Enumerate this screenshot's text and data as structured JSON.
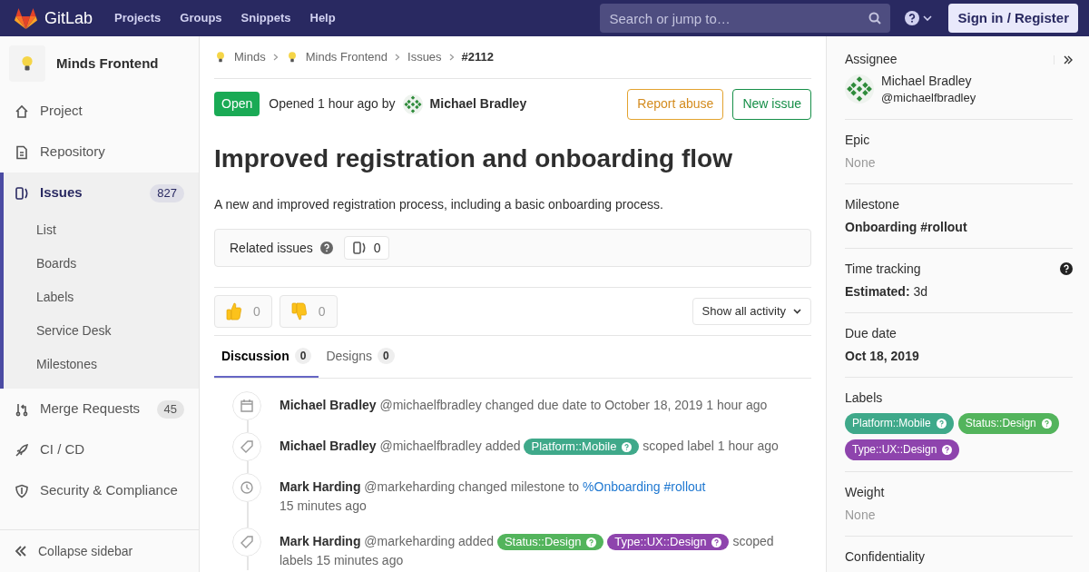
{
  "topbar": {
    "brand": "GitLab",
    "nav": [
      "Projects",
      "Groups",
      "Snippets",
      "Help"
    ],
    "search": {
      "placeholder": "Search or jump to…"
    },
    "sign_in": "Sign in / Register"
  },
  "sidebar": {
    "project": "Minds Frontend",
    "items": [
      {
        "label": "Project",
        "kind": "home",
        "selected": false
      },
      {
        "label": "Repository",
        "kind": "doc",
        "selected": false
      },
      {
        "label": "Issues",
        "kind": "issues",
        "selected": true,
        "count": "827",
        "children": [
          {
            "label": "List"
          },
          {
            "label": "Boards"
          },
          {
            "label": "Labels"
          },
          {
            "label": "Service Desk"
          },
          {
            "label": "Milestones"
          }
        ]
      },
      {
        "label": "Merge Requests",
        "kind": "merge",
        "selected": false,
        "count": "45"
      },
      {
        "label": "CI / CD",
        "kind": "rocket",
        "selected": false
      },
      {
        "label": "Security & Compliance",
        "kind": "shield",
        "selected": false
      }
    ],
    "collapse": "Collapse sidebar"
  },
  "breadcrumbs": [
    {
      "label": "Minds",
      "kind": "project",
      "current": false
    },
    {
      "label": "Minds Frontend",
      "kind": "project",
      "current": false
    },
    {
      "label": "Issues",
      "kind": "link",
      "current": false
    },
    {
      "label": "#2112",
      "kind": "link",
      "current": true
    }
  ],
  "issue": {
    "status": "Open",
    "opened": "Opened 1 hour ago by",
    "author": "Michael Bradley",
    "buttons": [
      {
        "label": "Report abuse",
        "kind": "warning"
      },
      {
        "label": "New issue",
        "kind": "success"
      }
    ],
    "title": "Improved registration and onboarding flow",
    "description": "A new and improved registration process, including a basic onboarding process.",
    "related": {
      "label": "Related issues",
      "count": "0"
    },
    "reactions": [
      {
        "kind": "thumbsup",
        "count": "0"
      },
      {
        "kind": "thumbsdown",
        "count": "0"
      }
    ],
    "activity_filter": "Show all activity",
    "tabs": [
      {
        "label": "Discussion",
        "count": "0",
        "selected": true
      },
      {
        "label": "Designs",
        "count": "0",
        "selected": false
      }
    ],
    "timeline": [
      {
        "kind": "calendar",
        "author": "Michael Bradley",
        "handle": "@michaelfbradley",
        "parts": [
          {
            "kind": "text",
            "text": "changed due date to October 18, 2019 1 hour ago"
          }
        ]
      },
      {
        "kind": "tag",
        "author": "Michael Bradley",
        "handle": "@michaelfbradley",
        "parts": [
          {
            "kind": "text",
            "text": "added"
          },
          {
            "kind": "label",
            "text": "Platform::Mobile",
            "color": "#3fa98a"
          },
          {
            "kind": "text",
            "text": "scoped label 1 hour ago"
          }
        ]
      },
      {
        "kind": "clock",
        "author": "Mark Harding",
        "handle": "@markeharding",
        "parts": [
          {
            "kind": "text",
            "text": "changed milestone to"
          },
          {
            "kind": "link",
            "text": "%Onboarding #rollout"
          },
          {
            "kind": "text",
            "text": "15 minutes ago"
          }
        ]
      },
      {
        "kind": "tag",
        "author": "Mark Harding",
        "handle": "@markeharding",
        "parts": [
          {
            "kind": "text",
            "text": "added"
          },
          {
            "kind": "label",
            "text": "Status::Design",
            "color": "#53b45c"
          },
          {
            "kind": "label",
            "text": "Type::UX::Design",
            "color": "#8e44ad"
          },
          {
            "kind": "text",
            "text": "scoped"
          },
          {
            "kind": "text",
            "text": "labels 15 minutes ago"
          }
        ]
      }
    ]
  },
  "right_sidebar": {
    "assignee": {
      "title": "Assignee",
      "name": "Michael Bradley",
      "handle": "@michaelfbradley"
    },
    "sections": [
      {
        "title": "Epic",
        "kind": "muted",
        "value": "None",
        "help": false
      },
      {
        "title": "Milestone",
        "kind": "bold",
        "value": "Onboarding #rollout",
        "help": false
      },
      {
        "title": "Time tracking",
        "kind": "rich",
        "value": "**Estimated:** 3d",
        "help": true
      },
      {
        "title": "Due date",
        "kind": "bold",
        "value": "Oct 18, 2019",
        "help": false
      },
      {
        "title": "Labels",
        "kind": "labels",
        "help": false,
        "labels": [
          {
            "text": "Platform::Mobile",
            "color": "#3fa98a"
          },
          {
            "text": "Status::Design",
            "color": "#53b45c"
          },
          {
            "text": "Type::UX::Design",
            "color": "#8e44ad"
          }
        ]
      },
      {
        "title": "Weight",
        "kind": "muted",
        "value": "None",
        "help": false
      },
      {
        "title": "Confidentiality",
        "kind": "heading",
        "help": false
      }
    ]
  }
}
